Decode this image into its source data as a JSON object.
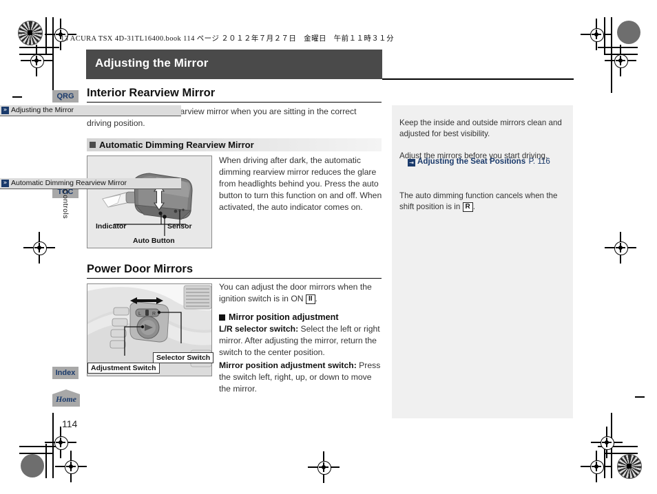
{
  "print_header": "13 ACURA TSX 4D-31TL16400.book  114 ページ  ２０１２年７月２７日　金曜日　午前１１時３１分",
  "page_title": "Adjusting the Mirror",
  "page_number": "114",
  "colors": {
    "title_band": "#4a4a4a",
    "tab_bg": "#a8a8a8",
    "tab_text": "#1a3a6b",
    "sidebar_bg": "#f0f0f0",
    "sidebar_header_bg": "#dcdcdc",
    "link": "#1a3a6b"
  },
  "tabs": [
    {
      "id": "qrg",
      "label": "QRG"
    },
    {
      "id": "toc",
      "label": "TOC"
    },
    {
      "id": "index",
      "label": "Index"
    },
    {
      "id": "home",
      "label": "Home"
    }
  ],
  "section_label": "Controls",
  "main": {
    "section1": {
      "heading": "Interior Rearview Mirror",
      "intro": "Adjust the angle of the rearview mirror when you are sitting in the correct driving position.",
      "subheading": "Automatic Dimming Rearview Mirror",
      "body": "When driving after dark, the automatic dimming rearview mirror reduces the glare from headlights behind you. Press the auto button to turn this function on and off. When activated, the auto indicator comes on.",
      "figure_callouts": {
        "indicator": "Indicator",
        "sensor": "Sensor",
        "auto_button": "Auto Button"
      }
    },
    "section2": {
      "heading": "Power Door Mirrors",
      "intro_a": "You can adjust the door mirrors when the ignition switch is in ON ",
      "intro_ignition_symbol": "II",
      "intro_b": ".",
      "subheading": "Mirror position adjustment",
      "para1_bold": "L/R selector switch:",
      "para1_rest": " Select the left or right mirror. After adjusting the mirror, return the switch to the center position.",
      "para2_bold": "Mirror position adjustment switch:",
      "para2_rest": " Press the switch left, right, up, or down to move the mirror.",
      "figure_callouts": {
        "selector": "Selector Switch",
        "adjustment": "Adjustment Switch"
      }
    }
  },
  "sidebar": {
    "note1": {
      "header": "Adjusting the Mirror",
      "para1": "Keep the inside and outside mirrors clean and adjusted for best visibility.",
      "para2": "Adjust the mirrors before you start driving.",
      "xref_label": "Adjusting the Seat Positions",
      "xref_page": "P. 116"
    },
    "note2": {
      "header": "Automatic Dimming Rearview Mirror",
      "para1_a": "The auto dimming function cancels when the shift position is in ",
      "para1_symbol": "R",
      "para1_b": "."
    }
  }
}
